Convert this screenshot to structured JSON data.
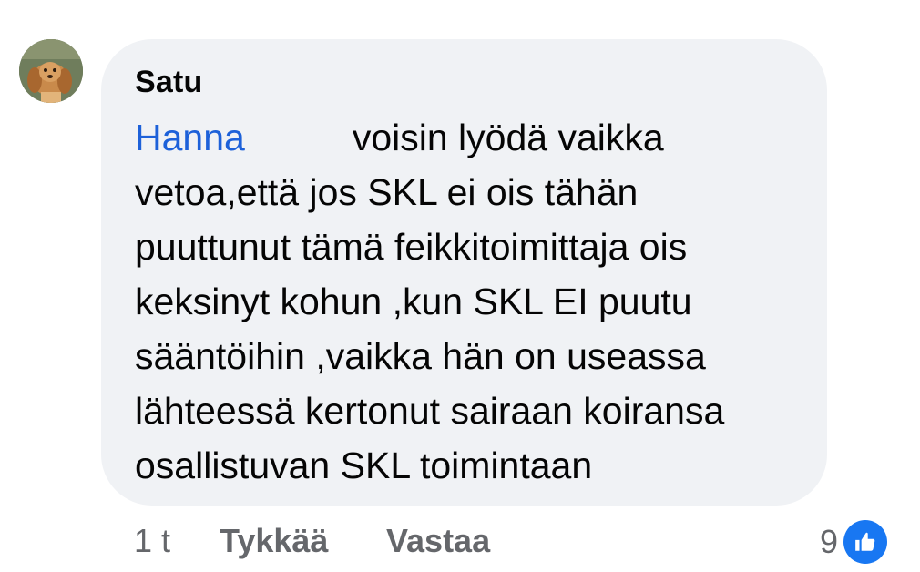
{
  "comment": {
    "author": "Satu",
    "mention": "Hanna",
    "body_lines": [
      "voisin lyödä vaikka",
      "vetoa,että jos SKL ei ois tähän",
      "puuttunut tämä feikkitoimittaja ois",
      "keksinyt kohun ,kun SKL EI puutu",
      "sääntöihin ,vaikka hän on useassa",
      "lähteessä kertonut sairaan koiransa",
      "osallistuvan SKL toimintaan"
    ],
    "timestamp": "1 t",
    "like_label": "Tykkää",
    "reply_label": "Vastaa",
    "reaction_count": "9",
    "reaction_icon": "thumbs-up-icon"
  },
  "colors": {
    "bubble": "#f0f2f5",
    "mention": "#1d61d9",
    "secondary_text": "#65676b",
    "like_badge": "#1877f2"
  }
}
